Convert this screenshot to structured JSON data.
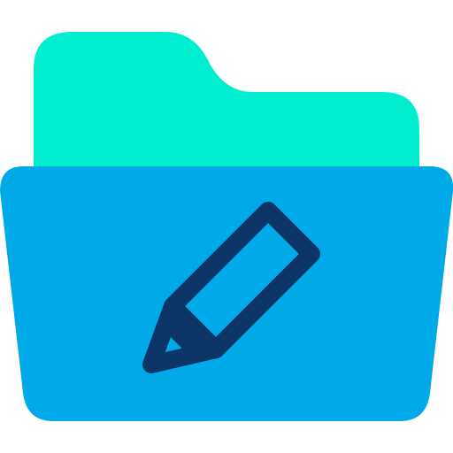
{
  "icon": {
    "name": "edit-folder-icon",
    "parts": [
      "folder-back-icon",
      "folder-front-icon",
      "pencil-icon"
    ]
  },
  "colors": {
    "folder_back": "#00EED0",
    "folder_front": "#00AAE8",
    "pencil_outline": "#0A3566",
    "background": "#FFFFFF"
  }
}
